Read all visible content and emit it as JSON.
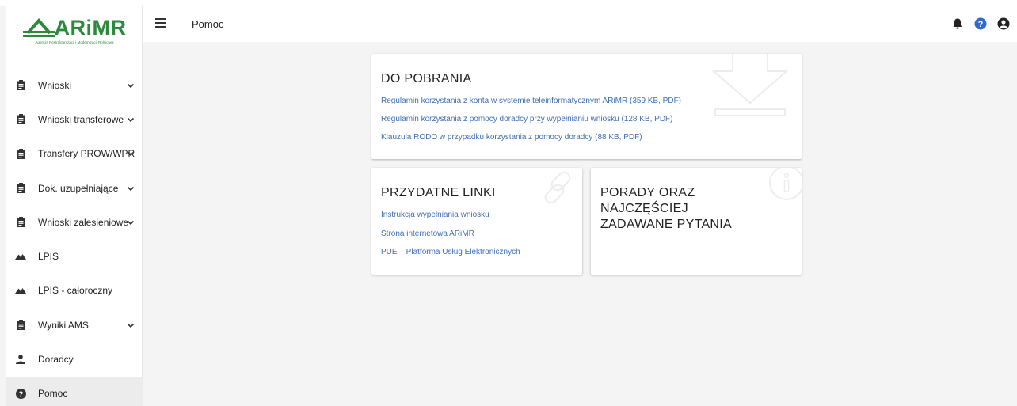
{
  "logo": {
    "text": "ARiMR",
    "subtitle": "Agencja Restrukturyzacji i Modernizacji Rolnictwa"
  },
  "sidebar": {
    "items": [
      {
        "label": "Wnioski",
        "icon": "clipboard-icon",
        "expandable": true
      },
      {
        "label": "Wnioski transferowe",
        "icon": "clipboard-icon",
        "expandable": true
      },
      {
        "label": "Transfery PROW/WPR",
        "icon": "clipboard-icon",
        "expandable": true
      },
      {
        "label": "Dok. uzupełniające",
        "icon": "clipboard-icon",
        "expandable": true
      },
      {
        "label": "Wnioski zalesieniowe",
        "icon": "clipboard-icon",
        "expandable": true
      },
      {
        "label": "LPIS",
        "icon": "mountains-icon",
        "expandable": false
      },
      {
        "label": "LPIS - całoroczny",
        "icon": "mountains-icon",
        "expandable": false
      },
      {
        "label": "Wyniki AMS",
        "icon": "clipboard-icon",
        "expandable": true
      },
      {
        "label": "Doradcy",
        "icon": "person-icon",
        "expandable": false
      },
      {
        "label": "Pomoc",
        "icon": "help-circle-icon",
        "expandable": false,
        "active": true
      }
    ]
  },
  "header": {
    "title": "Pomoc",
    "icons": [
      "bell-icon",
      "help-circle-icon",
      "account-circle-icon"
    ]
  },
  "downloads": {
    "title": "DO POBRANIA",
    "links": [
      "Regulamin korzystania z konta w systemie teleinformatycznym ARiMR (359 KB, PDF)",
      "Regulamin korzystania z pomocy doradcy przy wypełnianiu wniosku (128 KB, PDF)",
      "Klauzula RODO w przypadku korzystania z pomocy doradcy (88 KB, PDF)"
    ]
  },
  "links_card": {
    "title": "PRZYDATNE LINKI",
    "links": [
      "Instrukcja wypełniania wniosku",
      "Strona internetowa ARiMR",
      "PUE – Platforma Usług Elektronicznych"
    ]
  },
  "faq_card": {
    "title_lines": [
      "PORADY ORAZ",
      "NAJCZĘŚCIEJ",
      "ZADAWANE PYTANIA"
    ]
  },
  "colors": {
    "brand": "#2d8a3c",
    "link": "#3f6fb5",
    "background": "#f4f4f4",
    "help": "#2f6bc9"
  }
}
